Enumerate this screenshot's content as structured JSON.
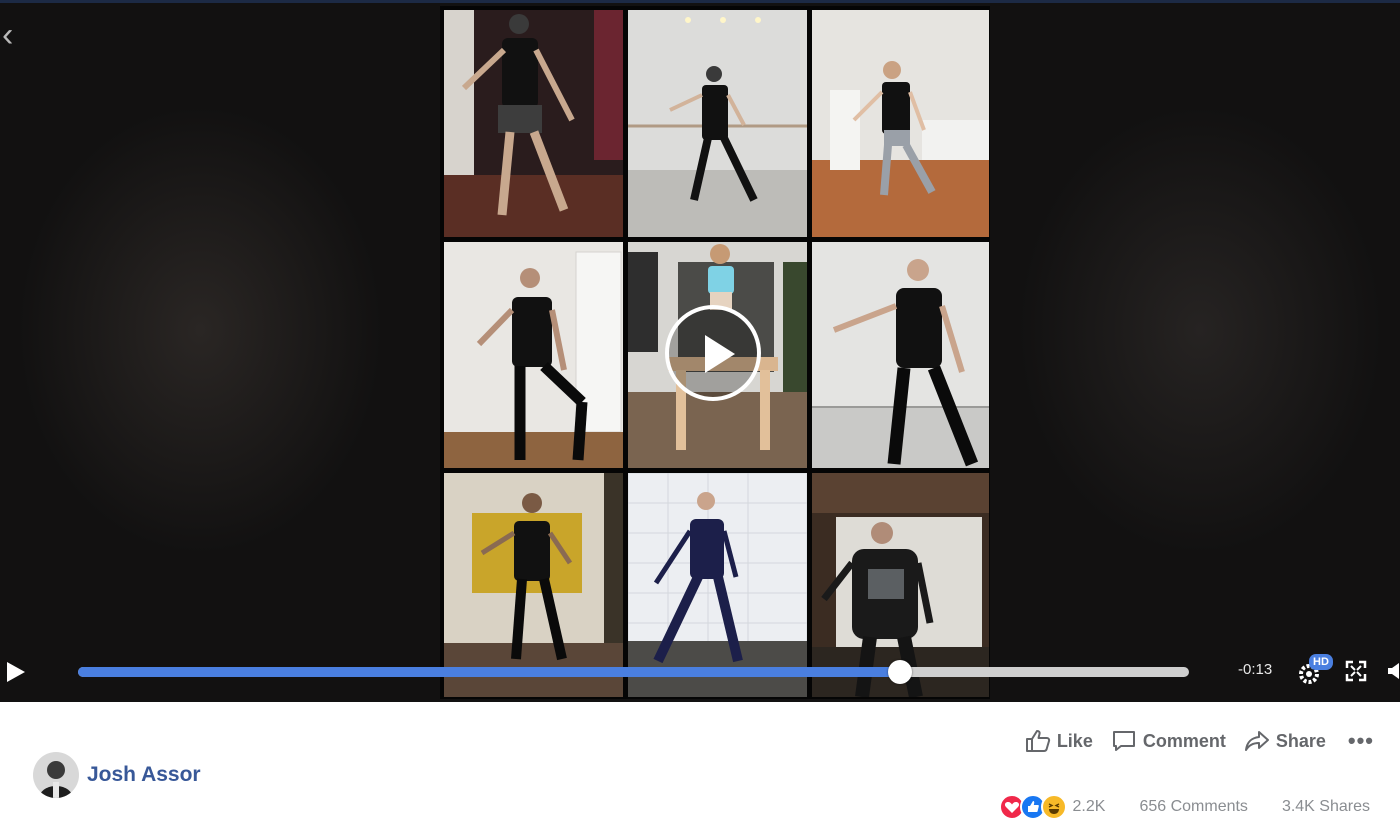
{
  "video": {
    "time_remaining": "-0:13",
    "quality_badge": "HD",
    "progress": 0.74
  },
  "post": {
    "author": "Josh Assor",
    "actions": {
      "like": "Like",
      "comment": "Comment",
      "share": "Share"
    },
    "stats": {
      "reactions": "2.2K",
      "comments": "656 Comments",
      "shares": "3.4K Shares"
    }
  },
  "icons": [
    "back-icon",
    "play-icon",
    "settings-gear-icon",
    "fullscreen-icon",
    "volume-icon",
    "like-icon",
    "comment-icon",
    "share-icon",
    "more-icon",
    "love-reaction-icon",
    "like-reaction-icon",
    "haha-reaction-icon"
  ],
  "colors": {
    "accent": "#4a7fe0",
    "author": "#385898",
    "action_text": "#65676b",
    "stat_text": "#8a8d91"
  }
}
